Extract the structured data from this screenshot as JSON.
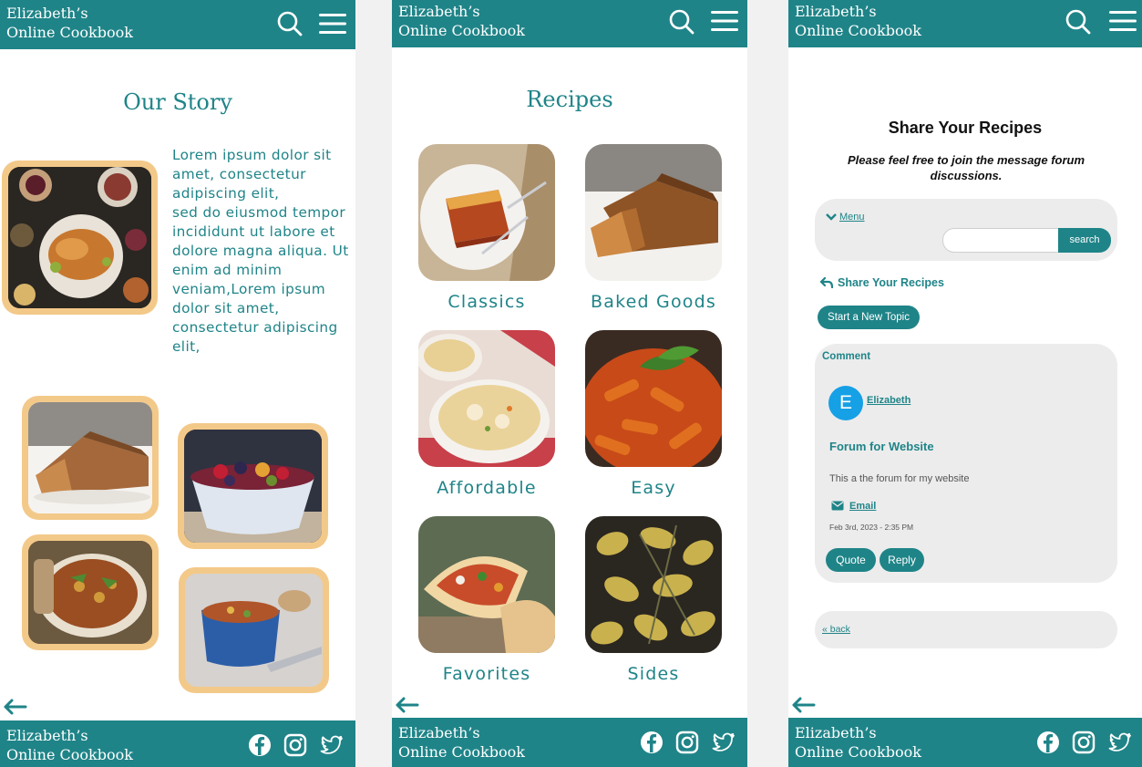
{
  "brand": {
    "line1": "Elizabeth’s",
    "line2": "Online Cookbook"
  },
  "colors": {
    "primary": "#1f8488",
    "frame": "#f3c989",
    "panel": "#ececec"
  },
  "header_icons": [
    "search-icon",
    "hamburger-menu-icon"
  ],
  "footer_icons": [
    "facebook-icon",
    "instagram-icon",
    "twitter-icon"
  ],
  "story": {
    "title": "Our Story",
    "lines": [
      "Lorem ipsum dolor sit",
      "amet, consectetur",
      "adipiscing elit,",
      "sed do eiusmod tempor",
      "incididunt ut labore et",
      "dolore magna aliqua. Ut",
      "enim ad minim",
      "veniam,Lorem ipsum",
      "dolor sit amet,",
      "consectetur adipiscing",
      "elit,"
    ]
  },
  "recipes": {
    "title": "Recipes",
    "categories": [
      "Classics",
      "Baked Goods",
      "Affordable",
      "Easy",
      "Favorites",
      "Sides"
    ]
  },
  "forum": {
    "title": "Share Your Recipes",
    "subtitle": "Please feel free to join the message forum discussions.",
    "menu_label": "Menu",
    "search_button": "search",
    "search_value": "",
    "breadcrumb": "Share Your Recipes",
    "new_topic": "Start a New Topic",
    "comment_label": "Comment",
    "avatar_letter": "E",
    "author": "Elizabeth",
    "topic_title": "Forum for Website",
    "body": "This a the forum for my website",
    "email_label": "Email",
    "timestamp": "Feb 3rd, 2023 - 2:35 PM",
    "quote": "Quote",
    "reply": "Reply",
    "back": "« back"
  }
}
